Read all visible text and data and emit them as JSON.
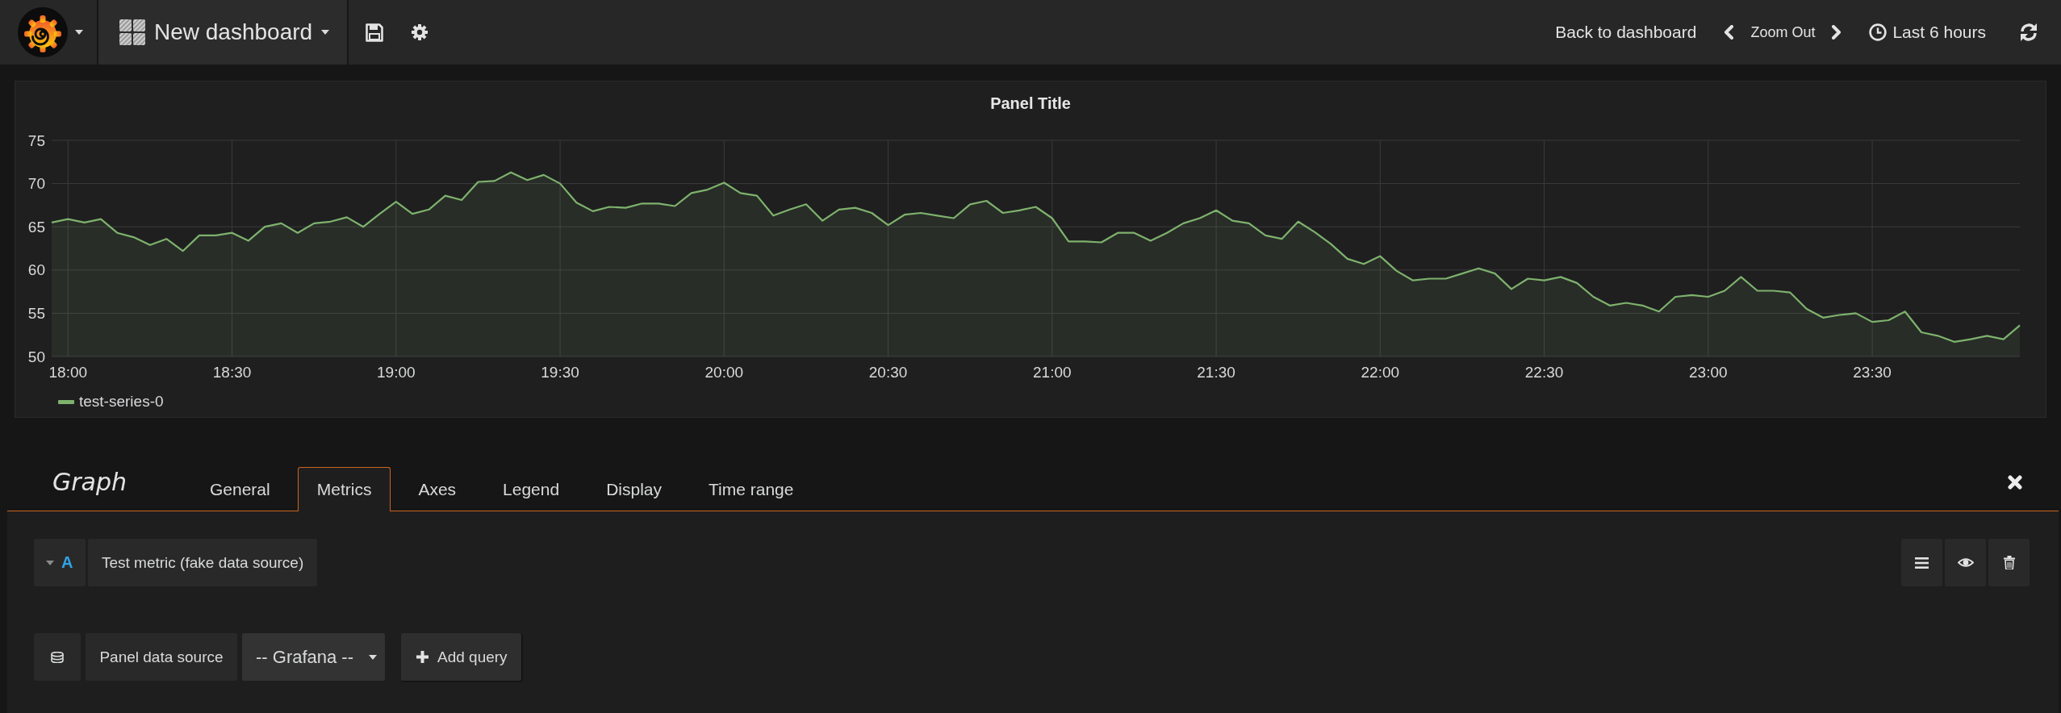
{
  "navbar": {
    "title": "New dashboard",
    "back_link": "Back to dashboard",
    "zoom_out": "Zoom Out",
    "time_range": "Last 6 hours"
  },
  "panel": {
    "title": "Panel Title",
    "chart_data": {
      "type": "area",
      "grid": true,
      "categories": [
        null,
        "18:00",
        null,
        null,
        null,
        null,
        null,
        null,
        null,
        null,
        null,
        "18:30",
        null,
        null,
        null,
        null,
        null,
        null,
        null,
        null,
        null,
        "19:00",
        null,
        null,
        null,
        null,
        null,
        null,
        null,
        null,
        null,
        "19:30",
        null,
        null,
        null,
        null,
        null,
        null,
        null,
        null,
        null,
        "20:00",
        null,
        null,
        null,
        null,
        null,
        null,
        null,
        null,
        null,
        "20:30",
        null,
        null,
        null,
        null,
        null,
        null,
        null,
        null,
        null,
        "21:00",
        null,
        null,
        null,
        null,
        null,
        null,
        null,
        null,
        null,
        "21:30",
        null,
        null,
        null,
        null,
        null,
        null,
        null,
        null,
        null,
        "22:00",
        null,
        null,
        null,
        null,
        null,
        null,
        null,
        null,
        null,
        "22:30",
        null,
        null,
        null,
        null,
        null,
        null,
        null,
        null,
        null,
        "23:00",
        null,
        null,
        null,
        null,
        null,
        null,
        null,
        null,
        null,
        "23:30",
        null,
        null,
        null,
        null,
        null,
        null,
        null,
        null,
        null
      ],
      "series": [
        {
          "name": "test-series-0",
          "color": "#7eb26d",
          "values": [
            65.5,
            65.9,
            65.5,
            65.9,
            64.3,
            63.8,
            62.9,
            63.6,
            62.2,
            64.0,
            64.0,
            64.3,
            63.4,
            65.0,
            65.4,
            64.3,
            65.4,
            65.6,
            66.1,
            65.0,
            66.5,
            67.9,
            66.5,
            67.0,
            68.6,
            68.1,
            70.2,
            70.3,
            71.3,
            70.4,
            71.0,
            70.0,
            67.8,
            66.8,
            67.3,
            67.2,
            67.7,
            67.7,
            67.4,
            68.9,
            69.3,
            70.1,
            68.9,
            68.6,
            66.3,
            67.0,
            67.6,
            65.7,
            67.0,
            67.2,
            66.6,
            65.2,
            66.4,
            66.6,
            66.3,
            66.0,
            67.6,
            68.0,
            66.6,
            66.9,
            67.3,
            66.0,
            63.3,
            63.3,
            63.2,
            64.3,
            64.3,
            63.4,
            64.3,
            65.4,
            66.0,
            66.9,
            65.7,
            65.4,
            64.0,
            63.6,
            65.6,
            64.4,
            63.0,
            61.3,
            60.7,
            61.6,
            59.9,
            58.8,
            59.0,
            59.0,
            59.6,
            60.2,
            59.6,
            57.8,
            59.0,
            58.8,
            59.2,
            58.5,
            56.9,
            55.9,
            56.2,
            55.9,
            55.2,
            56.9,
            57.1,
            56.9,
            57.6,
            59.2,
            57.6,
            57.6,
            57.4,
            55.5,
            54.5,
            54.8,
            55.0,
            54.0,
            54.2,
            55.2,
            52.8,
            52.4,
            51.7,
            52.0,
            52.4,
            52.0,
            53.6
          ]
        }
      ],
      "ylim": [
        50,
        75
      ],
      "yticks": [
        50,
        55,
        60,
        65,
        70,
        75
      ]
    }
  },
  "editor": {
    "title": "Graph",
    "tabs": [
      {
        "label": "General",
        "selected": false
      },
      {
        "label": "Metrics",
        "selected": true
      },
      {
        "label": "Axes",
        "selected": false
      },
      {
        "label": "Legend",
        "selected": false
      },
      {
        "label": "Display",
        "selected": false
      },
      {
        "label": "Time range",
        "selected": false
      }
    ],
    "queries": [
      {
        "ref": "A",
        "name": "Test metric (fake data source)",
        "expanded": true
      }
    ],
    "data_source": {
      "label": "Panel data source",
      "value": "-- Grafana --"
    },
    "add_query": "Add query"
  }
}
